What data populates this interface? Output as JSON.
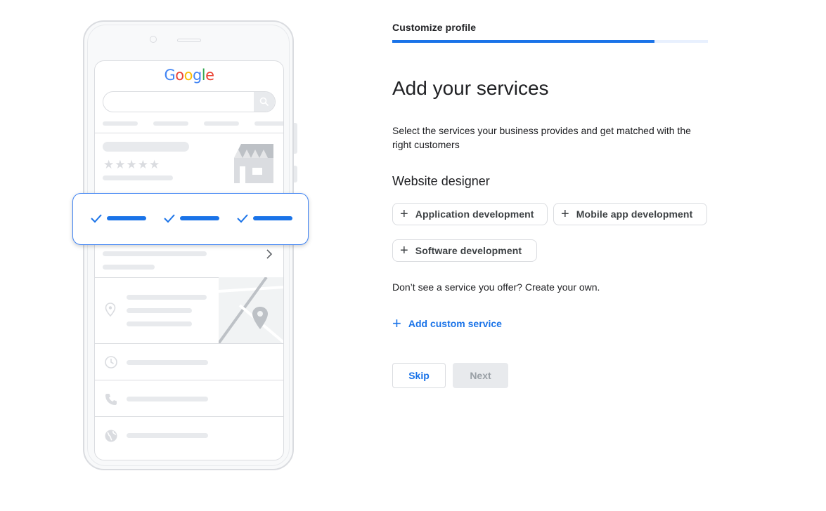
{
  "illustration": {
    "logo_letters": [
      "G",
      "o",
      "o",
      "g",
      "l",
      "e"
    ],
    "rating_stars": "★★★★★"
  },
  "header": {
    "step_label": "Customize profile",
    "progress_fraction": 0.83
  },
  "main": {
    "heading": "Add your services",
    "description": "Select the services your business provides and get matched with the right customers",
    "category": "Website designer",
    "services": [
      "Application development",
      "Mobile app development",
      "Software development"
    ],
    "custom_prompt": "Don’t see a service you offer? Create your own.",
    "add_custom_label": "Add custom service"
  },
  "footer": {
    "skip_label": "Skip",
    "next_label": "Next"
  },
  "colors": {
    "accent": "#1a73e8",
    "progress_track": "#e8f0fe",
    "disabled_bg": "#e8eaed",
    "disabled_text": "#9aa0a6"
  },
  "icons": {
    "chip_plus": "+",
    "add_custom": "+"
  }
}
